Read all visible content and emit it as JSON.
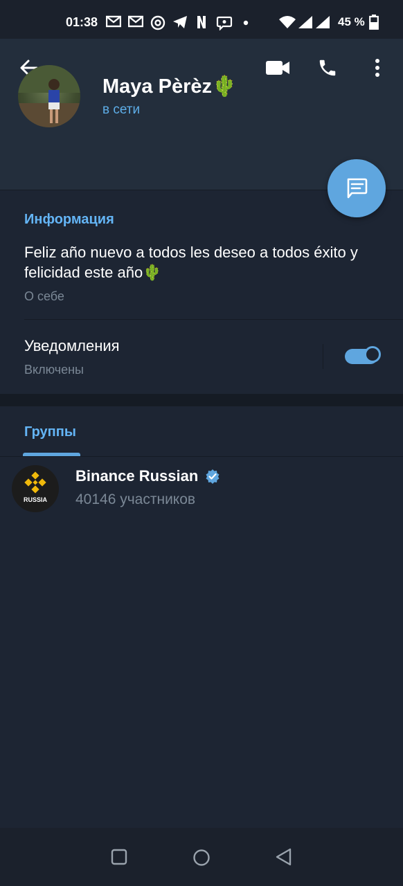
{
  "statusbar": {
    "time": "01:38",
    "battery_text": "45 %",
    "icons": [
      "gmail-icon",
      "gmail-icon",
      "at-icon",
      "telegram-icon",
      "netflix-icon",
      "viber-icon",
      "dot-icon",
      "wifi-icon",
      "signal-icon",
      "signal-icon",
      "battery-icon"
    ]
  },
  "header": {
    "back_icon": "back-arrow-icon",
    "video_icon": "video-call-icon",
    "call_icon": "phone-icon",
    "more_icon": "more-vertical-icon"
  },
  "profile": {
    "name": "Maya Pèrèz🌵",
    "status": "в сети"
  },
  "fab": {
    "icon": "message-icon"
  },
  "info": {
    "title": "Информация",
    "bio": "Feliz año nuevo a todos les deseo a todos éxito y felicidad este año🌵",
    "bio_label": "О себе",
    "notifications_title": "Уведомления",
    "notifications_status": "Включены",
    "notifications_enabled": true
  },
  "tabs": {
    "active_label": "Группы"
  },
  "groups": [
    {
      "name": "Binance Russian",
      "avatar_text": "RUSSIA",
      "members": "40146 участников",
      "verified": true
    }
  ],
  "colors": {
    "accent": "#5fa6df",
    "accent_text": "#64b5f6",
    "background": "#1d2533",
    "header": "#232e3c",
    "binance_yellow": "#f0b90b"
  },
  "navbar": {
    "icons": [
      "recents-square-icon",
      "home-circle-icon",
      "back-triangle-icon"
    ]
  }
}
